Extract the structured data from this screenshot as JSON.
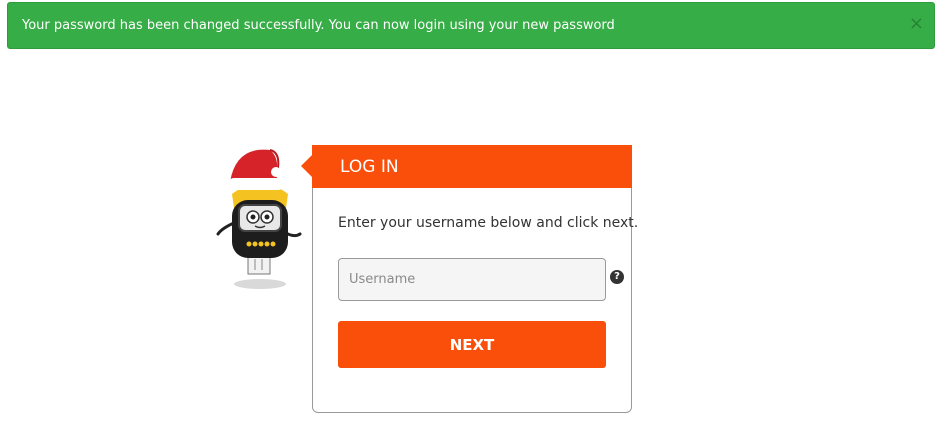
{
  "alert": {
    "message": "Your password has been changed successfully. You can now login using your new password",
    "close_symbol": "×",
    "color": "#36ad46"
  },
  "login": {
    "header_title": "LOG IN",
    "instructions": "Enter your username below and click next.",
    "username_placeholder": "Username",
    "username_value": "",
    "help_symbol": "?",
    "next_label": "NEXT",
    "accent_color": "#fa4f0a"
  },
  "mascot": {
    "icon": "usb-key-mascot-with-santa-hat"
  }
}
